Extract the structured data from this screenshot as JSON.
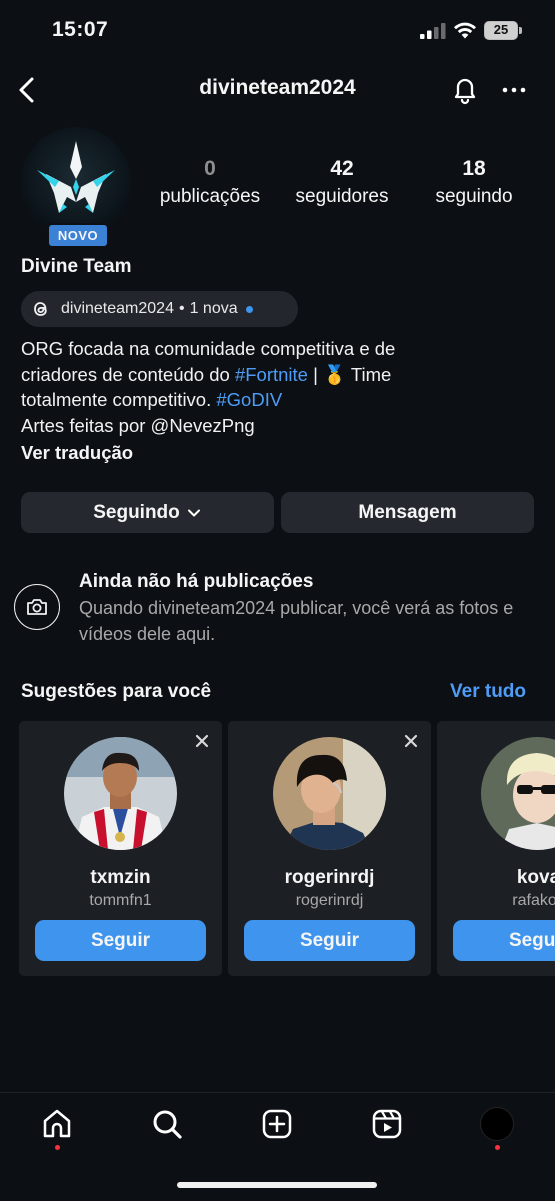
{
  "status_bar": {
    "time": "15:07",
    "battery": "25"
  },
  "header": {
    "username": "divineteam2024"
  },
  "profile": {
    "new_badge": "NOVO",
    "stats": [
      {
        "num": "0",
        "label": "publicações"
      },
      {
        "num": "42",
        "label": "seguidores"
      },
      {
        "num": "18",
        "label": "seguindo"
      }
    ],
    "display_name": "Divine Team",
    "threads": {
      "handle": "divineteam2024",
      "sep": "•",
      "new_label": "1 nova"
    },
    "bio": {
      "line1": "ORG focada na comunidade competitiva e de",
      "line2_a": "criadores de conteúdo do ",
      "tag1": "#Fortnite",
      "line2_b": " | 🥇 Time",
      "line3_a": "totalmente competitivo. ",
      "tag2": "#GoDIV",
      "line4": "Artes feitas por @NevezPng"
    },
    "translate": "Ver tradução"
  },
  "actions": {
    "following": "Seguindo",
    "message": "Mensagem"
  },
  "empty_state": {
    "title": "Ainda não há publicações",
    "desc": "Quando divineteam2024 publicar, você verá as fotos e vídeos dele aqui."
  },
  "suggestions": {
    "title": "Sugestões para você",
    "see_all": "Ver tudo",
    "follow_label": "Seguir",
    "cards": [
      {
        "name": "txmzin",
        "user": "tommfn1"
      },
      {
        "name": "rogerinrdj",
        "user": "rogerinrdj"
      },
      {
        "name": "kova",
        "user": "rafakov"
      }
    ]
  },
  "colors": {
    "accent": "#3f94ee",
    "link": "#4e9cf6",
    "background": "#0c1014",
    "notification": "#ff3040"
  },
  "icons": [
    "back-icon",
    "bell-icon",
    "more-icon",
    "threads-icon",
    "camera-icon",
    "close-icon",
    "home-icon",
    "search-icon",
    "create-icon",
    "reels-icon"
  ]
}
